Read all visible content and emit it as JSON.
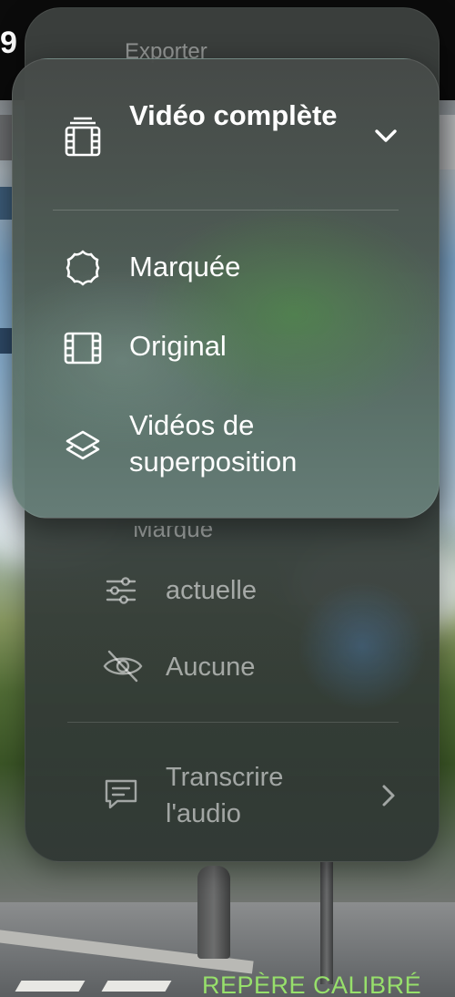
{
  "background": {
    "top_glyph": "9",
    "bottom_label": "REPÈRE CALIBRÉ"
  },
  "export_menu": {
    "title": "Exporter",
    "partial_item": "Marqué",
    "items": [
      {
        "icon": "sliders-icon",
        "label": "actuelle"
      },
      {
        "icon": "eye-slash-icon",
        "label": "Aucune"
      }
    ],
    "transcribe": {
      "icon": "chat-bubble-icon",
      "label": "Transcrire l'audio"
    }
  },
  "video_menu": {
    "header": {
      "icon": "film-stack-icon",
      "label": "Vidéo complète"
    },
    "items": [
      {
        "icon": "badge-icon",
        "label": "Marquée"
      },
      {
        "icon": "film-icon",
        "label": "Original"
      },
      {
        "icon": "layers-icon",
        "label": "Vidéos de superposition"
      }
    ]
  }
}
